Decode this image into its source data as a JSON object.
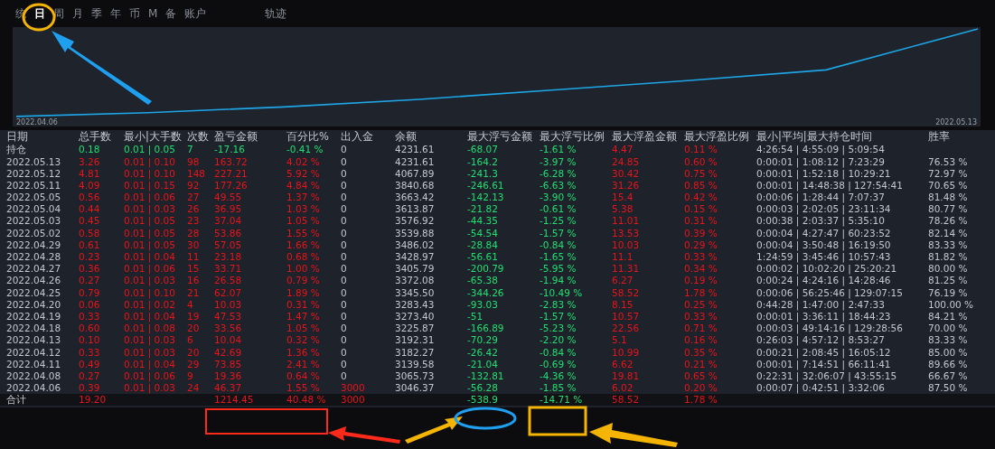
{
  "tabs": [
    {
      "label": "统",
      "selected": false
    },
    {
      "label": "日",
      "selected": true
    },
    {
      "label": "周",
      "selected": false
    },
    {
      "label": "月",
      "selected": false
    },
    {
      "label": "季",
      "selected": false
    },
    {
      "label": "年",
      "selected": false
    },
    {
      "label": "币",
      "selected": false
    },
    {
      "label": "M",
      "selected": false
    },
    {
      "label": "备",
      "selected": false
    },
    {
      "label": "账户",
      "selected": false
    },
    {
      "label": "轨迹",
      "selected": false
    }
  ],
  "chart": {
    "start_label": "2022.04.06",
    "end_label": "2022.05.13"
  },
  "table": {
    "columns": [
      {
        "label": "日期",
        "kind": "text"
      },
      {
        "label": "总手数",
        "kind": "result"
      },
      {
        "label": "最小|大手数",
        "kind": "result"
      },
      {
        "label": "次数",
        "kind": "result"
      },
      {
        "label": "盈亏金额",
        "kind": "result"
      },
      {
        "label": "百分比%",
        "kind": "result"
      },
      {
        "label": "出入金",
        "kind": "cash"
      },
      {
        "label": "余额",
        "kind": "text"
      },
      {
        "label": "最大浮亏金额",
        "kind": "adverse"
      },
      {
        "label": "最大浮亏比例",
        "kind": "adverse"
      },
      {
        "label": "最大浮盈金额",
        "kind": "favorable"
      },
      {
        "label": "最大浮盈比例",
        "kind": "favorable"
      },
      {
        "label": "最小|平均|最大持仓时间",
        "kind": "text"
      },
      {
        "label": "胜率",
        "kind": "text"
      }
    ],
    "rows": [
      {
        "kind": "position",
        "deposit": false,
        "cells": [
          "持仓",
          "0.18",
          "0.01 | 0.05",
          "7",
          "-17.16",
          "-0.41 %",
          "0",
          "4231.61",
          "-68.07",
          "-1.61 %",
          "4.47",
          "0.11 %",
          "4:26:54 | 4:55:09 | 5:09:54",
          null
        ]
      },
      {
        "kind": "day",
        "deposit": false,
        "cells": [
          "2022.05.13",
          "3.26",
          "0.01 | 0.10",
          "98",
          "163.72",
          "4.02 %",
          "0",
          "4231.61",
          "-164.2",
          "-3.97 %",
          "24.85",
          "0.60 %",
          "0:00:01 | 1:08:12 | 7:23:29",
          "76.53 %"
        ]
      },
      {
        "kind": "day",
        "deposit": false,
        "cells": [
          "2022.05.12",
          "4.81",
          "0.01 | 0.10",
          "148",
          "227.21",
          "5.92 %",
          "0",
          "4067.89",
          "-241.3",
          "-6.28 %",
          "30.42",
          "0.75 %",
          "0:00:01 | 1:52:18 | 10:29:21",
          "72.97 %"
        ]
      },
      {
        "kind": "day",
        "deposit": false,
        "cells": [
          "2022.05.11",
          "4.09",
          "0.01 | 0.15",
          "92",
          "177.26",
          "4.84 %",
          "0",
          "3840.68",
          "-246.61",
          "-6.63 %",
          "31.26",
          "0.85 %",
          "0:00:01 | 14:48:38 | 127:54:41",
          "70.65 %"
        ]
      },
      {
        "kind": "day",
        "deposit": false,
        "cells": [
          "2022.05.05",
          "0.56",
          "0.01 | 0.06",
          "27",
          "49.55",
          "1.37 %",
          "0",
          "3663.42",
          "-142.13",
          "-3.90 %",
          "15.4",
          "0.42 %",
          "0:00:06 | 1:28:44 | 7:07:37",
          "81.48 %"
        ]
      },
      {
        "kind": "day",
        "deposit": false,
        "cells": [
          "2022.05.04",
          "0.44",
          "0.01 | 0.03",
          "26",
          "36.95",
          "1.03 %",
          "0",
          "3613.87",
          "-21.82",
          "-0.61 %",
          "5.38",
          "0.15 %",
          "0:00:03 | 2:02:05 | 23:11:34",
          "80.77 %"
        ]
      },
      {
        "kind": "day",
        "deposit": false,
        "cells": [
          "2022.05.03",
          "0.45",
          "0.01 | 0.05",
          "23",
          "37.04",
          "1.05 %",
          "0",
          "3576.92",
          "-44.35",
          "-1.25 %",
          "11.01",
          "0.31 %",
          "0:00:38 | 2:03:37 | 5:35:10",
          "78.26 %"
        ]
      },
      {
        "kind": "day",
        "deposit": false,
        "cells": [
          "2022.05.02",
          "0.58",
          "0.01 | 0.05",
          "28",
          "53.86",
          "1.55 %",
          "0",
          "3539.88",
          "-54.54",
          "-1.57 %",
          "13.53",
          "0.39 %",
          "0:00:04 | 4:27:47 | 60:23:52",
          "82.14 %"
        ]
      },
      {
        "kind": "day",
        "deposit": false,
        "cells": [
          "2022.04.29",
          "0.61",
          "0.01 | 0.05",
          "30",
          "57.05",
          "1.66 %",
          "0",
          "3486.02",
          "-28.84",
          "-0.84 %",
          "10.03",
          "0.29 %",
          "0:00:04 | 3:50:48 | 16:19:50",
          "83.33 %"
        ]
      },
      {
        "kind": "day",
        "deposit": false,
        "cells": [
          "2022.04.28",
          "0.23",
          "0.01 | 0.04",
          "11",
          "23.18",
          "0.68 %",
          "0",
          "3428.97",
          "-56.61",
          "-1.65 %",
          "11.1",
          "0.33 %",
          "1:24:59 | 3:45:46 | 10:57:43",
          "81.82 %"
        ]
      },
      {
        "kind": "day",
        "deposit": false,
        "cells": [
          "2022.04.27",
          "0.36",
          "0.01 | 0.06",
          "15",
          "33.71",
          "1.00 %",
          "0",
          "3405.79",
          "-200.79",
          "-5.95 %",
          "11.31",
          "0.34 %",
          "0:00:02 | 10:02:20 | 25:20:21",
          "80.00 %"
        ]
      },
      {
        "kind": "day",
        "deposit": false,
        "cells": [
          "2022.04.26",
          "0.27",
          "0.01 | 0.03",
          "16",
          "26.58",
          "0.79 %",
          "0",
          "3372.08",
          "-65.38",
          "-1.94 %",
          "6.27",
          "0.19 %",
          "0:00:24 | 4:24:16 | 14:28:46",
          "81.25 %"
        ]
      },
      {
        "kind": "day",
        "deposit": false,
        "cells": [
          "2022.04.25",
          "0.79",
          "0.01 | 0.10",
          "21",
          "62.07",
          "1.89 %",
          "0",
          "3345.50",
          "-344.26",
          "-10.49 %",
          "58.52",
          "1.78 %",
          "0:00:06 | 56:25:46 | 129:07:15",
          "76.19 %"
        ]
      },
      {
        "kind": "day",
        "deposit": false,
        "cells": [
          "2022.04.20",
          "0.06",
          "0.01 | 0.02",
          "4",
          "10.03",
          "0.31 %",
          "0",
          "3283.43",
          "-93.03",
          "-2.83 %",
          "8.15",
          "0.25 %",
          "0:44:28 | 1:47:00 | 2:47:33",
          "100.00 %"
        ]
      },
      {
        "kind": "day",
        "deposit": false,
        "cells": [
          "2022.04.19",
          "0.33",
          "0.01 | 0.04",
          "19",
          "47.53",
          "1.47 %",
          "0",
          "3273.40",
          "-51",
          "-1.57 %",
          "10.57",
          "0.33 %",
          "0:00:01 | 3:36:11 | 18:44:23",
          "84.21 %"
        ]
      },
      {
        "kind": "day",
        "deposit": false,
        "cells": [
          "2022.04.18",
          "0.60",
          "0.01 | 0.08",
          "20",
          "33.56",
          "1.05 %",
          "0",
          "3225.87",
          "-166.89",
          "-5.23 %",
          "22.56",
          "0.71 %",
          "0:00:03 | 49:14:16 | 129:28:56",
          "70.00 %"
        ]
      },
      {
        "kind": "day",
        "deposit": false,
        "cells": [
          "2022.04.13",
          "0.10",
          "0.01 | 0.03",
          "6",
          "10.04",
          "0.32 %",
          "0",
          "3192.31",
          "-70.29",
          "-2.20 %",
          "5.1",
          "0.16 %",
          "0:26:03 | 4:57:12 | 8:53:27",
          "83.33 %"
        ]
      },
      {
        "kind": "day",
        "deposit": false,
        "cells": [
          "2022.04.12",
          "0.33",
          "0.01 | 0.03",
          "20",
          "42.69",
          "1.36 %",
          "0",
          "3182.27",
          "-26.42",
          "-0.84 %",
          "10.99",
          "0.35 %",
          "0:00:21 | 2:08:45 | 16:05:12",
          "85.00 %"
        ]
      },
      {
        "kind": "day",
        "deposit": false,
        "cells": [
          "2022.04.11",
          "0.49",
          "0.01 | 0.04",
          "29",
          "73.85",
          "2.41 %",
          "0",
          "3139.58",
          "-21.04",
          "-0.69 %",
          "6.62",
          "0.21 %",
          "0:00:01 | 7:14:51 | 66:11:41",
          "89.66 %"
        ]
      },
      {
        "kind": "day",
        "deposit": false,
        "cells": [
          "2022.04.08",
          "0.27",
          "0.01 | 0.06",
          "9",
          "19.36",
          "0.64 %",
          "0",
          "3065.73",
          "-132.81",
          "-4.36 %",
          "19.81",
          "0.65 %",
          "0:22:31 | 32:06:07 | 43:55:15",
          "66.67 %"
        ]
      },
      {
        "kind": "day",
        "deposit": true,
        "cells": [
          "2022.04.06",
          "0.39",
          "0.01 | 0.03",
          "24",
          "46.37",
          "1.55 %",
          "3000",
          "3046.37",
          "-56.28",
          "-1.85 %",
          "6.02",
          "0.20 %",
          "0:00:07 | 0:42:51 | 3:32:06",
          "87.50 %"
        ]
      },
      {
        "kind": "total",
        "deposit": true,
        "cells": [
          "合计",
          "19.20",
          null,
          null,
          "1214.45",
          "40.48 %",
          "3000",
          null,
          "-538.9",
          "-14.71 %",
          "58.52",
          "1.78 %",
          null,
          null
        ]
      }
    ]
  }
}
